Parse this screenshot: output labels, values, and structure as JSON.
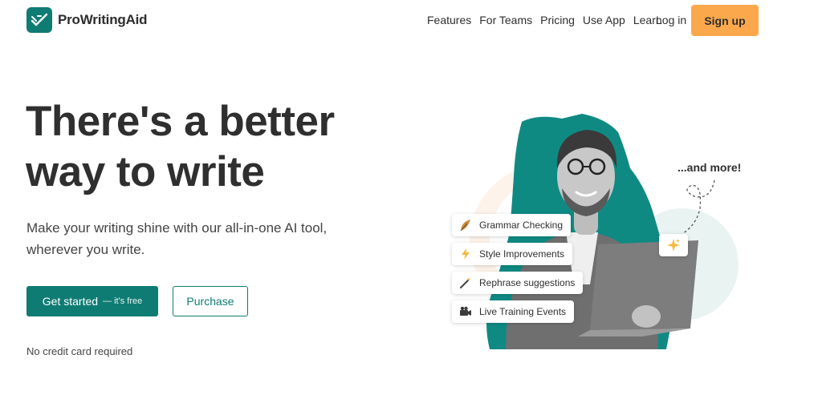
{
  "brand": {
    "name": "ProWritingAid"
  },
  "nav": {
    "links": [
      "Features",
      "For Teams",
      "Pricing",
      "Use App",
      "Learn"
    ],
    "login": "Log in",
    "signup": "Sign up"
  },
  "hero": {
    "headline": "There's a better\nway to write",
    "subtitle": "Make your writing shine with our all-in-one AI tool,\nwherever you write.",
    "primary_button": "Get started",
    "primary_suffix": "— it's free",
    "secondary_button": "Purchase",
    "note": "No credit card required"
  },
  "features": [
    {
      "label": "Grammar Checking",
      "icon": "feather-icon"
    },
    {
      "label": "Style Improvements",
      "icon": "lightning-icon"
    },
    {
      "label": "Rephrase suggestions",
      "icon": "magic-wand-icon"
    },
    {
      "label": "Live Training Events",
      "icon": "video-camera-icon"
    }
  ],
  "more_label": "...and more!",
  "colors": {
    "brand": "#0f7c74",
    "accent": "#fba84d"
  }
}
